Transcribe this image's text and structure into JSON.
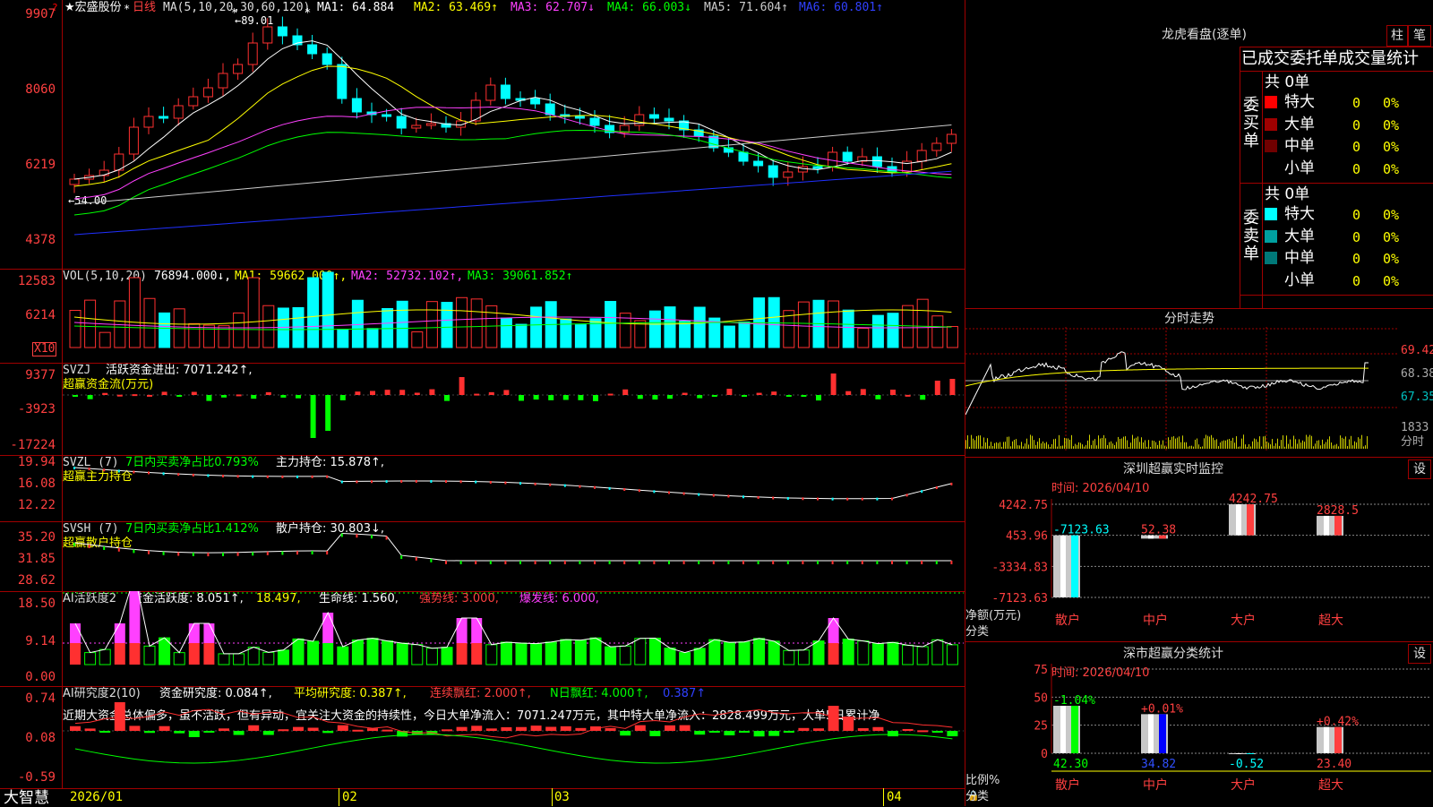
{
  "stock": {
    "title": "宏盛股份",
    "period": "日线",
    "ma_label": "MA(5,10,20,30,60,120)",
    "ma_values": [
      {
        "label": "MA1: 64.884",
        "color": "#ffffff"
      },
      {
        "label": "MA2: 63.469↑",
        "color": "#ffff00"
      },
      {
        "label": "MA3: 62.707↓",
        "color": "#ff40ff"
      },
      {
        "label": "MA4: 66.003↓",
        "color": "#00ff00"
      },
      {
        "label": "MA5: 71.604↑",
        "color": "#cccccc"
      },
      {
        "label": "MA6: 60.801↑",
        "color": "#0000ff"
      }
    ],
    "y_ticks": [
      "9907",
      "8060",
      "6219",
      "4378"
    ],
    "high_mark": "89.01",
    "low_mark": "54.00"
  },
  "volume": {
    "label": "VOL(5,10,20)",
    "value": "76894.000↓,",
    "ma1": "MA1: 59662.000↑,",
    "ma2": "MA2: 52732.102↑,",
    "ma3": "MA3: 39061.852↑",
    "y_ticks": [
      "12583",
      "6214"
    ],
    "unit": "X10"
  },
  "svzj": {
    "label": "SVZJ",
    "text1": "活跃资金进出: 7071.242↑,",
    "text2": "超赢资金流(万元)",
    "y_ticks": [
      "9377",
      "-3923",
      "-17224"
    ]
  },
  "svzl": {
    "label": "SVZL (7)",
    "text1": "7日内买卖净占比0.793%",
    "text2": "主力持仓: 15.878↑,",
    "text3": "超赢主力持仓",
    "y_ticks": [
      "19.94",
      "16.08",
      "12.22"
    ]
  },
  "svsh": {
    "label": "SVSH (7)",
    "text1": "7日内买卖净占比1.412%",
    "text2": "散户持仓: 30.803↓,",
    "text3": "超赢散户持仓",
    "y_ticks": [
      "35.20",
      "31.85",
      "28.62"
    ]
  },
  "ai1": {
    "label": "AI活跃度2",
    "text1": "资金活跃度: 8.051↑,",
    "text2": "18.497,",
    "text3": "生命线: 1.560,",
    "text4": "强势线: 3.000,",
    "text5": "爆发线: 6.000,",
    "y_ticks": [
      "18.50",
      "9.14",
      "0.00"
    ]
  },
  "ai2": {
    "label": "AI研究度2(10)",
    "text1": "资金研究度: 0.084↑,",
    "text2": "平均研究度: 0.387↑,",
    "text3": "连续飘红: 2.000↑,",
    "text4": "N日飘红: 4.000↑,",
    "text5": "0.387↑",
    "comment": "近期大资金总体偏多，虽不活跃，但有异动，宜关注大资金的持续性，今日大单净流入：7071.247万元，其中特大单净流入：2828.499万元，大单5日累计净",
    "y_ticks": [
      "0.74",
      "0.08",
      "-0.59"
    ]
  },
  "xaxis": {
    "brand": "大智慧",
    "dates": [
      "2026/01",
      "02",
      "03",
      "04"
    ]
  },
  "right": {
    "dragon_title": "龙虎看盘(逐单)",
    "btn_zhu": "柱",
    "btn_bi": "笔",
    "stat_header": "已成交委托单成交量统计",
    "buy_label": "委买单",
    "sell_label": "委卖单",
    "buy_total": "共 0单",
    "sell_total": "共 0单",
    "buy_rows": [
      {
        "name": "特大",
        "count": "0",
        "pct": "0%",
        "color": "#ff0000"
      },
      {
        "name": "大单",
        "count": "0",
        "pct": "0%",
        "color": "#a00000"
      },
      {
        "name": "中单",
        "count": "0",
        "pct": "0%",
        "color": "#700000"
      },
      {
        "name": "小单",
        "count": "0",
        "pct": "0%",
        "color": "#000000"
      }
    ],
    "sell_rows": [
      {
        "name": "特大",
        "count": "0",
        "pct": "0%",
        "color": "#00ffff"
      },
      {
        "name": "大单",
        "count": "0",
        "pct": "0%",
        "color": "#00a0a0"
      },
      {
        "name": "中单",
        "count": "0",
        "pct": "0%",
        "color": "#007878"
      },
      {
        "name": "小单",
        "count": "0",
        "pct": "0%",
        "color": "#000000"
      }
    ],
    "intraday_title": "分时走势",
    "intraday_ticks": [
      "69.42",
      "68.38",
      "67.35",
      "1833"
    ],
    "intraday_unit": "分时",
    "monitor_title": "深圳超赢实时监控",
    "monitor_btn": "设",
    "monitor_time": "时间: 2026/04/10",
    "monitor_ticks": [
      "4242.75",
      "453.96",
      "-3334.83",
      "-7123.63"
    ],
    "monitor_ylabel": "净额(万元)",
    "monitor_xlabel": "分类",
    "classify_title": "深市超赢分类统计",
    "classify_btn": "设",
    "classify_time": "时间: 2026/04/10",
    "classify_ticks": [
      "75",
      "50",
      "25",
      "0"
    ],
    "classify_ylabel": "比例%",
    "classify_xlabel": "分类",
    "categories": [
      "散户",
      "中户",
      "大户",
      "超大"
    ]
  },
  "chart_data": [
    {
      "type": "bar",
      "title": "深圳超赢实时监控",
      "ylabel": "净额(万元)",
      "categories": [
        "散户",
        "中户",
        "大户",
        "超大"
      ],
      "values": [
        -7123.63,
        52.38,
        4242.75,
        2828.5
      ],
      "ylim": [
        -7123.63,
        4242.75
      ],
      "colors": [
        "#00ffff",
        "#ff4040",
        "#ff4040",
        "#ff4040"
      ]
    },
    {
      "type": "bar",
      "title": "深市超赢分类统计",
      "ylabel": "比例%",
      "categories": [
        "散户",
        "中户",
        "大户",
        "超大"
      ],
      "values": [
        42.3,
        34.82,
        -0.52,
        23.4
      ],
      "changes": [
        "-1.04%",
        "+0.01%",
        "",
        "+0.42%"
      ],
      "ylim": [
        0,
        75
      ],
      "colors": [
        "#00ff00",
        "#0000ff",
        "#00ffff",
        "#ff4040"
      ]
    }
  ]
}
